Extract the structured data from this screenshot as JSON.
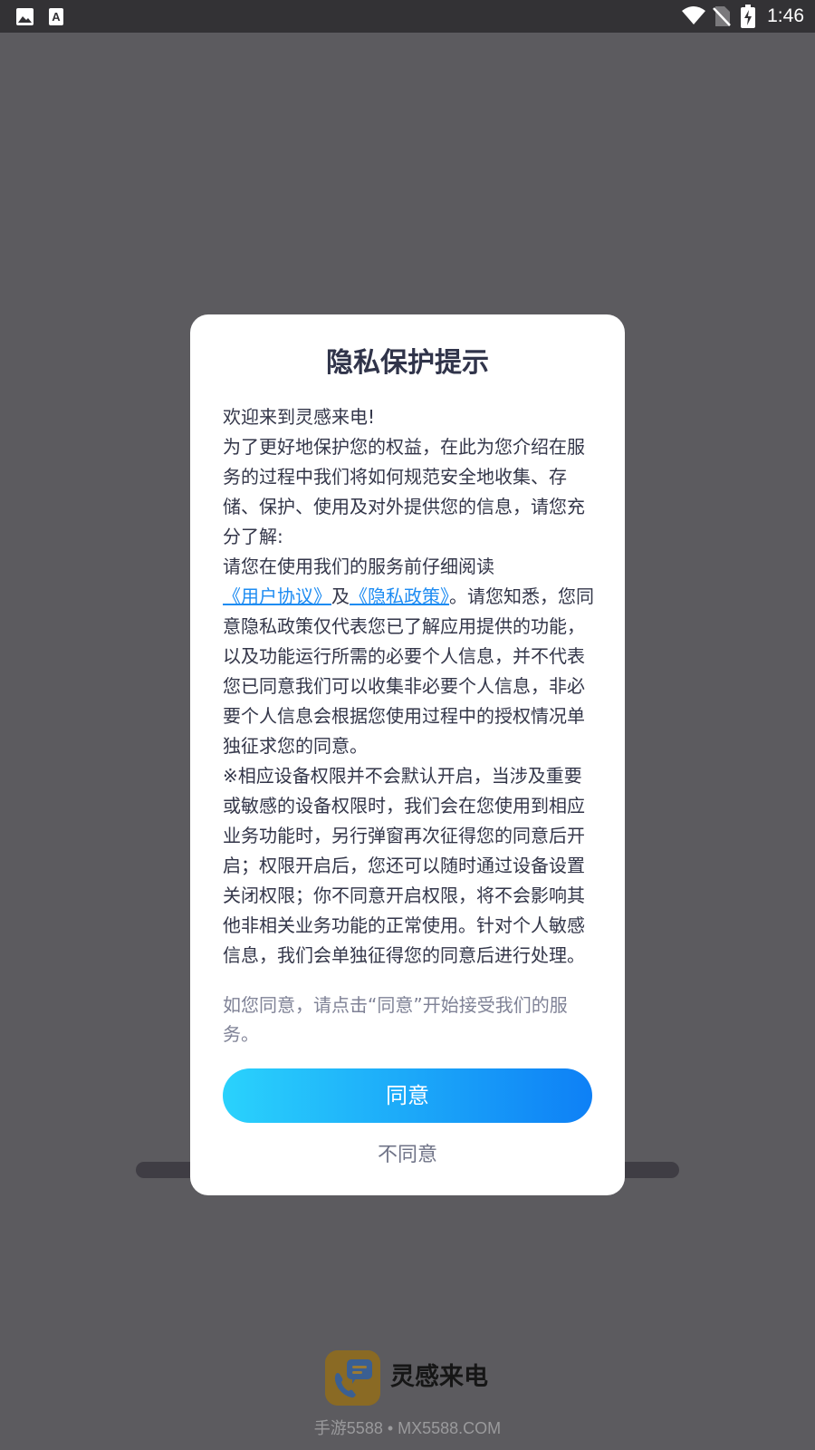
{
  "status_bar": {
    "time": "1:46",
    "left_icons": [
      "image-icon",
      "font-icon"
    ],
    "right_icons": [
      "wifi-icon",
      "no-sim-icon",
      "battery-charging-icon"
    ]
  },
  "dialog": {
    "title": "隐私保护提示",
    "greeting": "欢迎来到灵感来电!",
    "intro": "为了更好地保护您的权益，在此为您介绍在服务的过程中我们将如何规范安全地收集、存储、保护、使用及对外提供您的信息，请您充分了解:",
    "read_prefix": "请您在使用我们的服务前仔细阅读",
    "user_agreement_link": "《用户协议》",
    "and_text": "及",
    "privacy_policy_link": "《隐私政策》",
    "consent_text": "。请您知悉，您同意隐私政策仅代表您已了解应用提供的功能，以及功能运行所需的必要个人信息，并不代表您已同意我们可以收集非必要个人信息，非必要个人信息会根据您使用过程中的授权情况单独征求您的同意。",
    "permissions_text": "※相应设备权限并不会默认开启，当涉及重要或敏感的设备权限时，我们会在您使用到相应业务功能时，另行弹窗再次征得您的同意后开启；权限开启后，您还可以随时通过设备设置关闭权限；你不同意开启权限，将不会影响其他非相关业务功能的正常使用。针对个人敏感信息，我们会单独征得您的同意后进行处理。",
    "hint": "如您同意，请点击“同意”开始接受我们的服务。",
    "agree_label": "同意",
    "disagree_label": "不同意"
  },
  "background": {
    "app_name": "灵感来电",
    "watermark": "手游5588 • MX5588.COM"
  },
  "colors": {
    "overlay": "#5c5b5f",
    "link": "#1e8cf2",
    "button_gradient_start": "#2ad2fc",
    "button_gradient_end": "#0e80f6"
  }
}
